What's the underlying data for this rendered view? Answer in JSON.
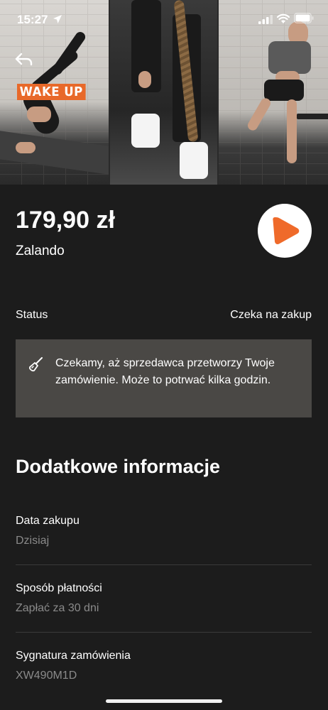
{
  "status_bar": {
    "time": "15:27",
    "icons": [
      "location-arrow-icon",
      "signal-icon",
      "wifi-icon",
      "battery-icon"
    ]
  },
  "hero": {
    "banner_text": "WAKE UP",
    "banner_color": "#e8692a"
  },
  "nav": {
    "back_icon": "back-arrow-icon"
  },
  "order": {
    "price": "179,90 zł",
    "merchant": "Zalando",
    "logo_icon": "zalando-logo",
    "logo_color": "#ef6a2a"
  },
  "status": {
    "label": "Status",
    "value": "Czeka na zakup"
  },
  "info_box": {
    "icon": "hourglass-broom-icon",
    "text": "Czekamy, aż sprzedawca przetworzy Twoje zamówienie. Może to potrwać kilka godzin."
  },
  "details": {
    "title": "Dodatkowe informacje",
    "rows": [
      {
        "label": "Data zakupu",
        "value": "Dzisiaj"
      },
      {
        "label": "Sposób płatności",
        "value": "Zapłać za 30 dni"
      },
      {
        "label": "Sygnatura zamówienia",
        "value": "XW490M1D"
      }
    ]
  },
  "colors": {
    "background": "#1c1c1c",
    "info_box": "#4a4845",
    "secondary_text": "#8a8a8a"
  }
}
